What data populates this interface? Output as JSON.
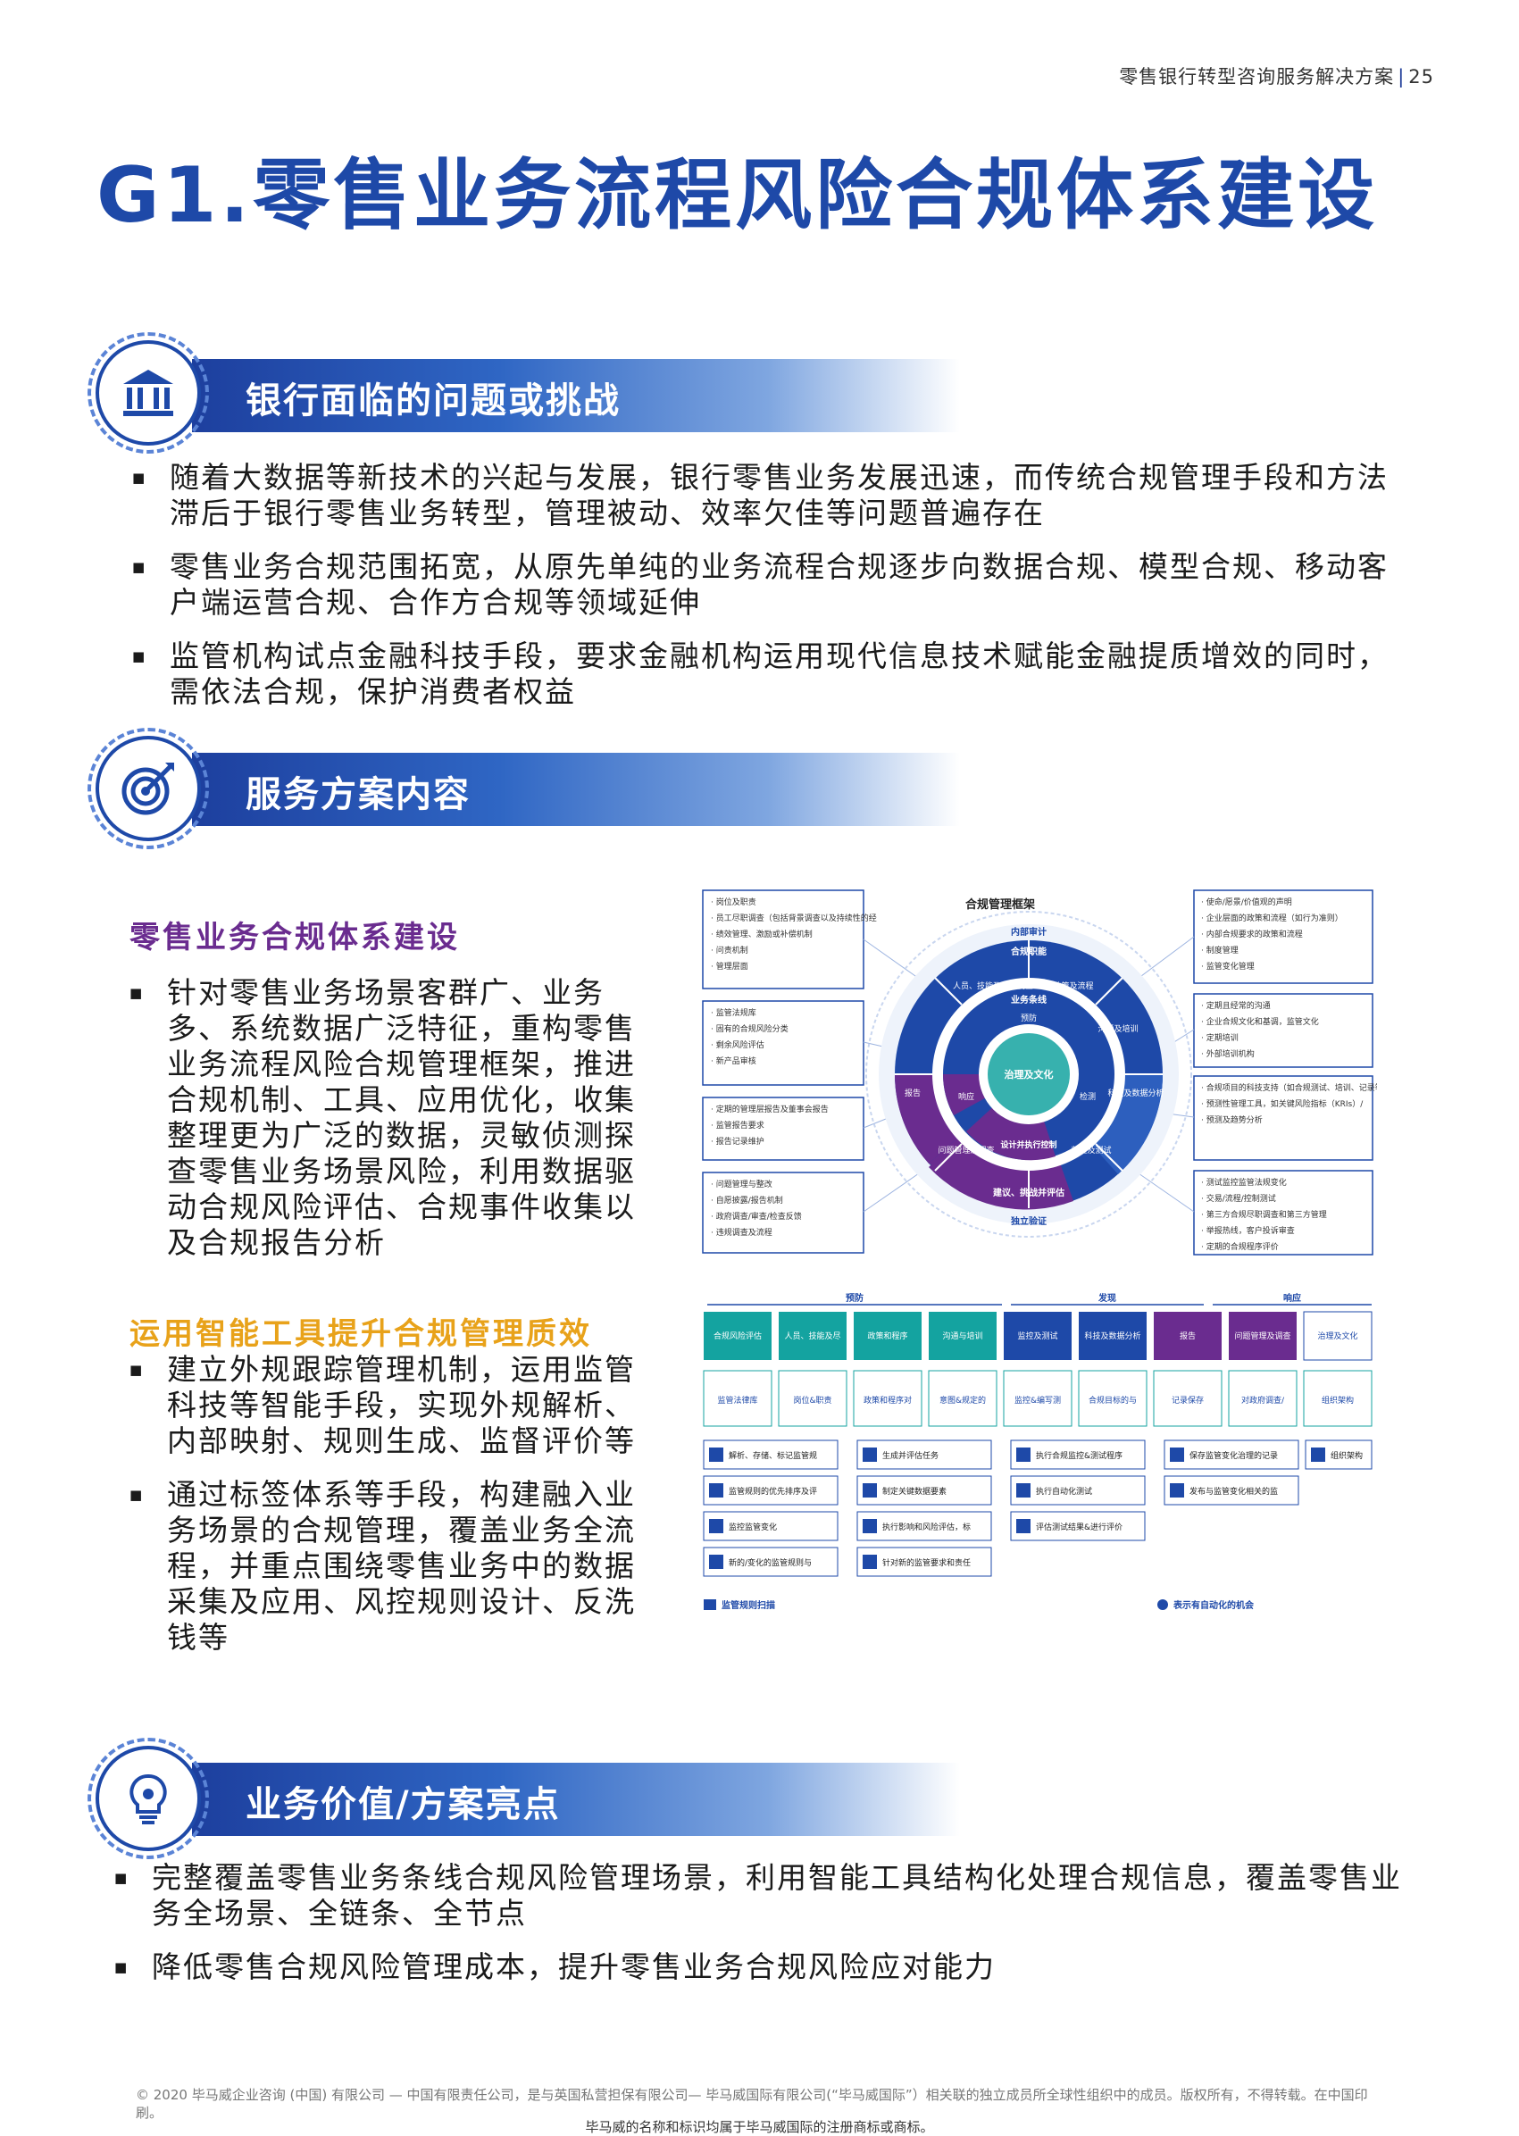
{
  "header": {
    "doc_title": "零售银行转型咨询服务解决方案",
    "page_number": "25"
  },
  "page_title": "G1.零售业务流程风险合规体系建设",
  "section1": {
    "heading": "银行面临的问题或挑战",
    "bullets": [
      "随着大数据等新技术的兴起与发展，银行零售业务发展迅速，而传统合规管理手段和方法滞后于银行零售业务转型，管理被动、效率欠佳等问题普遍存在",
      "零售业务合规范围拓宽，从原先单纯的业务流程合规逐步向数据合规、模型合规、移动客户端运营合规、合作方合规等领域延伸",
      "监管机构试点金融科技手段，要求金融机构运用现代信息技术赋能金融提质增效的同时，需依法合规，保护消费者权益"
    ]
  },
  "section2": {
    "heading": "服务方案内容",
    "sub1": {
      "title": "零售业务合规体系建设",
      "bullets": [
        "针对零售业务场景客群广、业务多、系统数据广泛特征，重构零售业务流程风险合规管理框架，推进合规机制、工具、应用优化，收集整理更为广泛的数据，灵敏侦测探查零售业务场景风险，利用数据驱动合规风险评估、合规事件收集以及合规报告分析"
      ]
    },
    "sub2": {
      "title": "运用智能工具提升合规管理质效",
      "bullets": [
        "建立外规跟踪管理机制，运用监管科技等智能手段，实现外规解析、内部映射、规则生成、监督评价等",
        "通过标签体系等手段，构建融入业务场景的合规管理，覆盖业务全流程，并重点围绕零售业务中的数据采集及应用、风控规则设计、反洗钱等"
      ]
    },
    "diagram1": {
      "title": "合规管理框架",
      "left_boxes": [
        [
          "岗位及职责",
          "员工尽职调查（包括背景调查以及持续性的经验测评）",
          "绩效管理、激励或补偿机制",
          "问责机制",
          "管理层面"
        ],
        [
          "监管法规库",
          "固有的合规风险分类",
          "剩余风险评估",
          "新产品审核"
        ],
        [
          "定期的管理层报告及董事会报告",
          "监管报告要求",
          "报告记录维护"
        ],
        [
          "问题管理与整改",
          "自愿披露/报告机制",
          "政府调查/审查/检查反馈",
          "违规调查及流程"
        ]
      ],
      "right_boxes": [
        [
          "使命/愿景/价值观的声明",
          "企业层面的政策和流程（如行为准则）",
          "内部合规要求的政策和流程",
          "制度管理",
          "监管变化管理"
        ],
        [
          "定期且经常的沟通",
          "企业合规文化和基调，监管文化",
          "定期培训",
          "外部培训机构"
        ],
        [
          "合规项目的科技支持（如合规测试、培训、记录等）",
          "预测性管理工具，如关键风险指标（KRIs）/关键绩效指标（KPIs）",
          "预测及趋势分析"
        ],
        [
          "测试监控监管法规变化",
          "交易/流程/控制测试",
          "第三方合规尽职调查和第三方管理",
          "举报热线，客户投诉审查",
          "定期的合规程序评价"
        ]
      ],
      "ring_labels": {
        "top": "内部审计",
        "bottom": "独立验证",
        "outer": [
          "合规职能",
          "政策及流程",
          "沟通及培训",
          "科技及数据分析",
          "监控及测试",
          "建议、挑战并评估",
          "问题管理及调查",
          "报告",
          "人员、技能及尽职调查"
        ],
        "middle": [
          "业务条线",
          "预防",
          "检测",
          "响应",
          "设计并执行控制"
        ],
        "center": "治理及文化"
      }
    },
    "diagram2": {
      "phases": [
        "预防",
        "发现",
        "响应"
      ],
      "top_boxes": [
        "合规风险评估",
        "人员、技能及尽职调查",
        "政策和程序",
        "沟通与培训",
        "监控及测试",
        "科技及数据分析",
        "报告",
        "问题管理及调查",
        "治理及文化"
      ],
      "mid_boxes": [
        "监管法律库",
        "岗位&职责",
        "政策和程序对监管要求的映射",
        "意图&规定的沟通与培训",
        "监控&编写测试管理化",
        "合规目标的与科技支持",
        "记录保存",
        "对政府调查/测试/检查的回应",
        "组织架构"
      ],
      "items_col1": [
        "解析、存储、标记监管规则",
        "监管规则的优先排序及评估",
        "监控监管变化",
        "新的/变化的监管规则与流程要素的工作流程序"
      ],
      "items_col2": [
        "生成并评估任务",
        "制定关键数据要素",
        "执行影响和风险评估，标识制度缺陷并计划补救",
        "针对新的监管要求和责任开发合规测试脚本"
      ],
      "items_col3": [
        "执行合规监控&测试程序",
        "执行自动化测试",
        "评估测试结果&进行评价"
      ],
      "items_col4": [
        "保存监管变化治理的记录",
        "发布与监管变化相关的监管报告的管理联系"
      ],
      "items_col5": [
        "组织架构"
      ],
      "legend1": "监管规则扫描",
      "legend2": "表示有自动化的机会"
    }
  },
  "section3": {
    "heading": "业务价值/方案亮点",
    "bullets": [
      "完整覆盖零售业务条线合规风险管理场景，利用智能工具结构化处理合规信息，覆盖零售业务全场景、全链条、全节点",
      "降低零售合规风险管理成本，提升零售业务合规风险应对能力"
    ]
  },
  "footer": {
    "copyright": "© 2020 毕马威企业咨询 (中国) 有限公司 — 中国有限责任公司，是与英国私营担保有限公司— 毕马威国际有限公司(“毕马威国际”）相关联的独立成员所全球性组织中的成员。版权所有，不得转载。在中国印刷。",
    "trademark": "毕马威的名称和标识均属于毕马威国际的注册商标或商标。"
  },
  "colors": {
    "brand_blue": "#1e49a8",
    "purple": "#6a2c8f",
    "gold": "#e8a21a",
    "teal": "#14a3a0"
  }
}
